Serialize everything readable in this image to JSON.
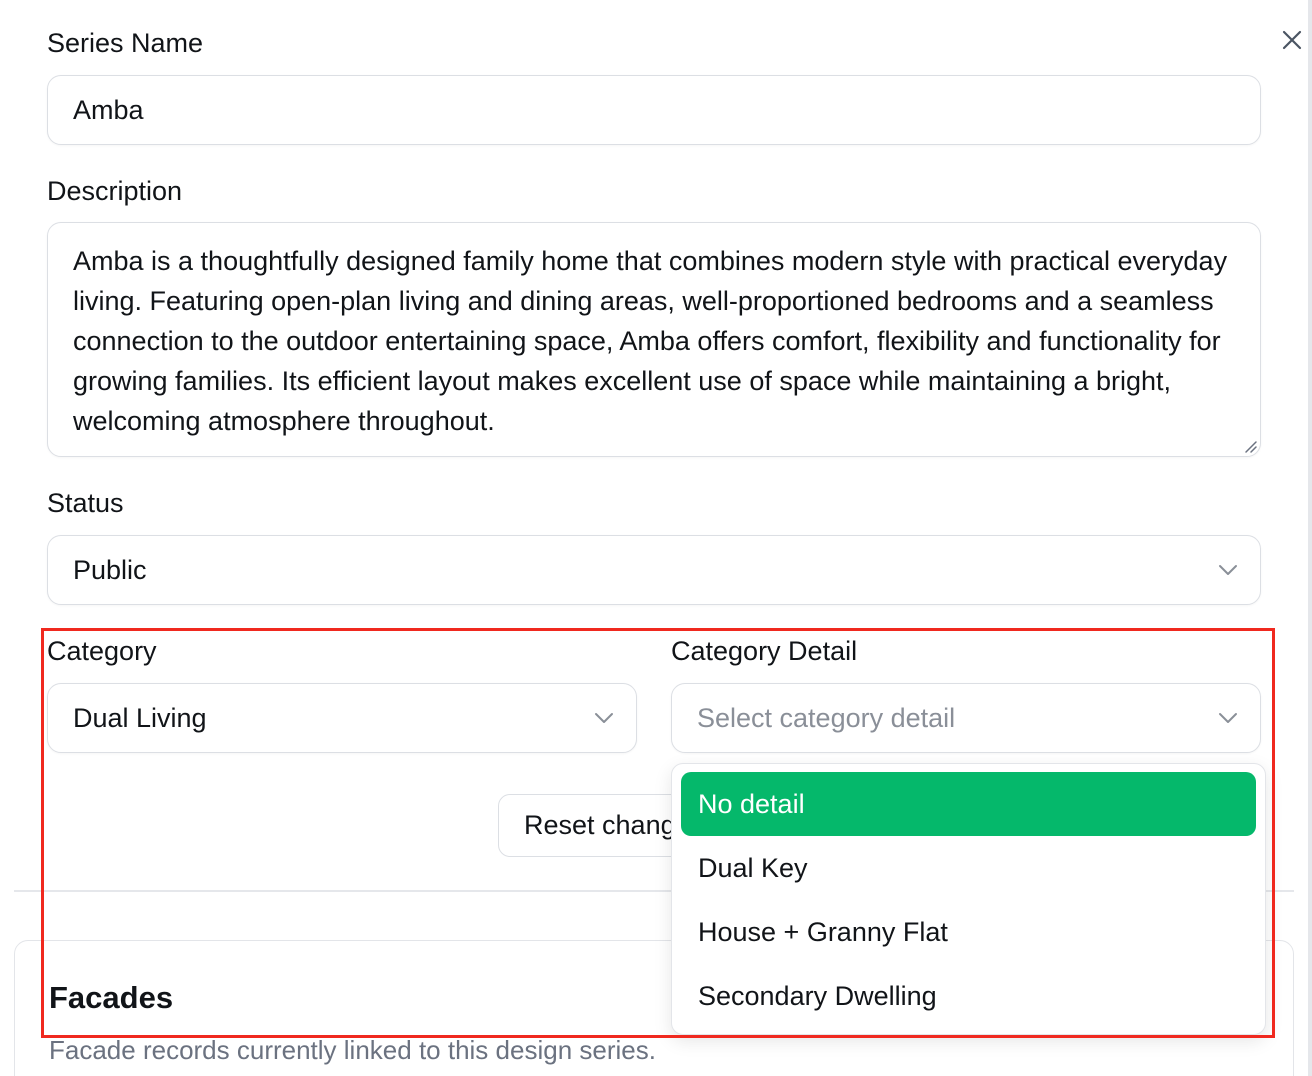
{
  "series_name": {
    "label": "Series Name",
    "value": "Amba"
  },
  "description": {
    "label": "Description",
    "value": "Amba is a thoughtfully designed family home that combines modern style with practical everyday living. Featuring open-plan living and dining areas, well-proportioned bedrooms and a seamless connection to the outdoor entertaining space, Amba offers comfort, flexibility and functionality for growing families. Its efficient layout makes excellent use of space while maintaining a bright, welcoming atmosphere throughout."
  },
  "status": {
    "label": "Status",
    "value": "Public"
  },
  "category": {
    "label": "Category",
    "value": "Dual Living"
  },
  "category_detail": {
    "label": "Category Detail",
    "placeholder": "Select category detail",
    "options": [
      "No detail",
      "Dual Key",
      "House + Granny Flat",
      "Secondary Dwelling"
    ],
    "highlighted_option": "No detail"
  },
  "reset_button": {
    "label": "Reset changes"
  },
  "facades": {
    "title": "Facades",
    "subtitle": "Facade records currently linked to this design series."
  },
  "icons": {
    "close": "close-icon",
    "chevron": "chevron-down-icon",
    "resize": "resize-grip-icon"
  },
  "colors": {
    "accent_selected": "#05b86b",
    "highlight_border": "#f0291f",
    "placeholder_text": "#8a8f98",
    "border": "#dcdfe4"
  }
}
